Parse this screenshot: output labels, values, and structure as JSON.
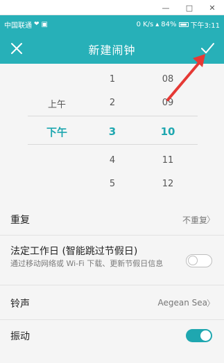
{
  "window": {
    "minimize": "—",
    "maximize": "□",
    "close": "✕"
  },
  "status_bar": {
    "carrier": "中国联通",
    "network_speed": "0 K/s",
    "battery": "84%",
    "time": "下午3:11"
  },
  "app_bar": {
    "title": "新建闹钟"
  },
  "picker": {
    "ampm": [
      "上午",
      "下午"
    ],
    "ampm_selected": "下午",
    "hours": [
      "1",
      "2",
      "3",
      "4",
      "5"
    ],
    "hour_selected": "3",
    "minutes": [
      "08",
      "09",
      "10",
      "11",
      "12"
    ],
    "minute_selected": "10"
  },
  "settings": {
    "repeat": {
      "label": "重复",
      "value": "不重复"
    },
    "workday": {
      "label": "法定工作日 (智能跳过节假日)",
      "subtitle": "通过移动网络或 Wi-Fi 下载、更新节假日信息",
      "enabled": false
    },
    "ringtone": {
      "label": "铃声",
      "value": "Aegean Sea"
    },
    "vibrate": {
      "label": "振动",
      "enabled": true
    }
  },
  "colors": {
    "accent": "#27b0b8",
    "annotation_arrow": "#e53935"
  }
}
